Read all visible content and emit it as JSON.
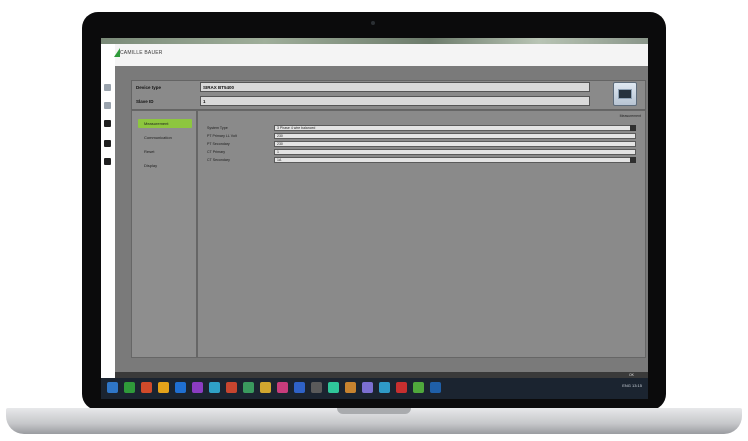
{
  "app": {
    "logo_text": "CAMILLE BAUER",
    "device_type_label": "Device type",
    "device_type_value": "SIRAX BT5400",
    "slave_id_label": "Slave ID",
    "slave_id_value": "1"
  },
  "menu": {
    "items": [
      {
        "label": "Measurement",
        "active": true
      },
      {
        "label": "Communication",
        "active": false
      },
      {
        "label": "Reset",
        "active": false
      },
      {
        "label": "Display",
        "active": false
      }
    ]
  },
  "content": {
    "section_title": "Measurement",
    "fields": [
      {
        "label": "System Type",
        "value": "3 Phase 4 wire balanced",
        "dropdown": true
      },
      {
        "label": "PT Primary LL Volt",
        "value": "230",
        "dropdown": false
      },
      {
        "label": "PT Secondary",
        "value": "230",
        "dropdown": false
      },
      {
        "label": "CT Primary",
        "value": "1",
        "dropdown": false
      },
      {
        "label": "CT Secondary",
        "value": "1A",
        "dropdown": true
      }
    ]
  },
  "footer": {
    "ok_label": "OK"
  },
  "taskbar": {
    "tray_text": "ENG   13:15",
    "icon_colors": [
      "#2f76c7",
      "#2f9a3a",
      "#d04a2a",
      "#e3a21a",
      "#1f6fd1",
      "#8a3cc2",
      "#2fa1c7",
      "#c7452f",
      "#3a9a5e",
      "#d0a62f",
      "#c73c7c",
      "#2f62c7",
      "#5a5a5a",
      "#2fc79a",
      "#c7832f",
      "#7b6fd1",
      "#2f9ac7",
      "#c72f2f",
      "#4fa83c",
      "#1f5fa8"
    ]
  },
  "colors": {
    "active_menu": "#8dc63f",
    "app_bg": "#7a7a7a",
    "taskbar": "#1b2430"
  }
}
